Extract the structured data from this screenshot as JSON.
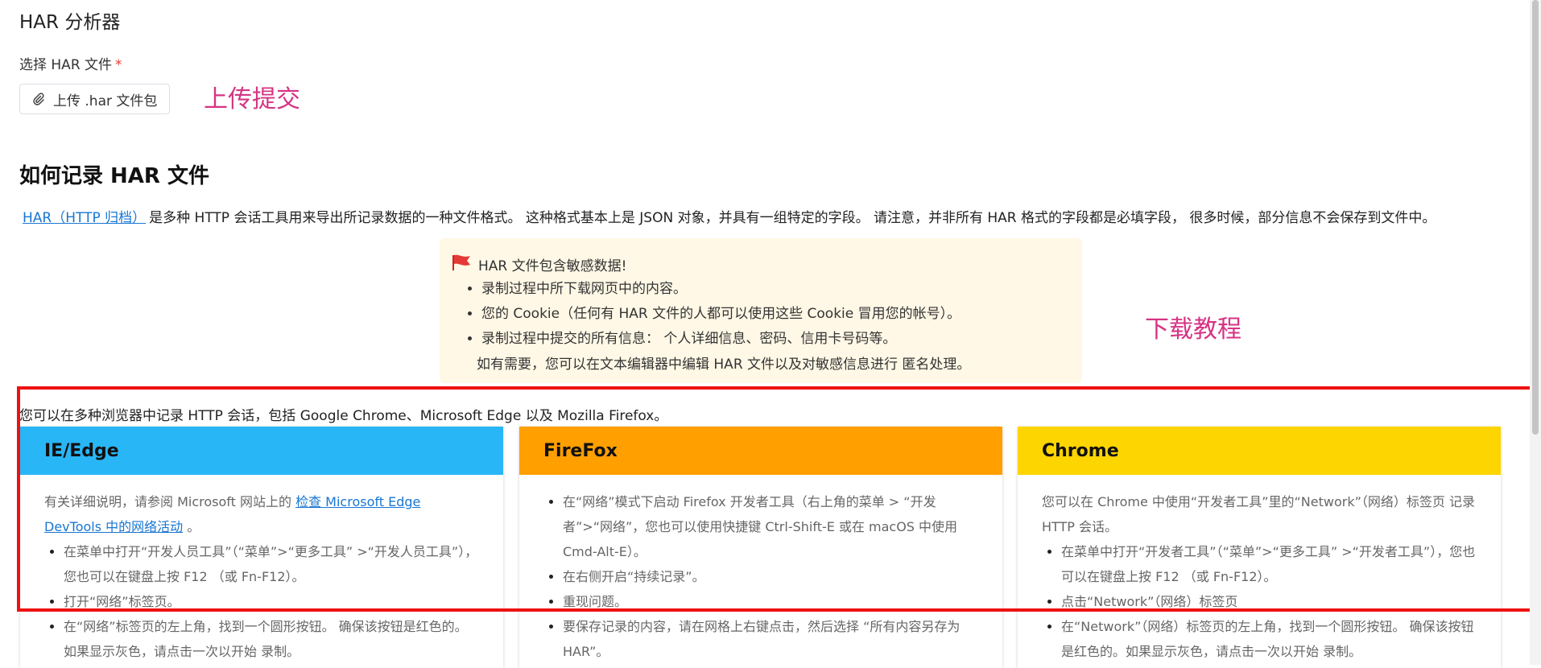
{
  "page": {
    "title": "HAR 分析器",
    "file_label": "选择 HAR 文件",
    "required_mark": "*",
    "upload_button": "上传 .har 文件包"
  },
  "annotations": {
    "upload": "上传提交",
    "download": "下载教程"
  },
  "section": {
    "title": "如何记录 HAR 文件",
    "intro_link": "HAR（HTTP 归档）",
    "intro_text": "是多种 HTTP 会话工具用来导出所记录数据的一种文件格式。 这种格式基本上是 JSON 对象，并具有一组特定的字段。 请注意，并非所有 HAR 格式的字段都是必填字段， 很多时候，部分信息不会保存到文件中。"
  },
  "warning": {
    "title": "HAR 文件包含敏感数据!",
    "items": [
      "录制过程中所下载网页中的内容。",
      "您的 Cookie（任何有 HAR 文件的人都可以使用这些 Cookie 冒用您的帐号）。",
      "录制过程中提交的所有信息： 个人详细信息、密码、信用卡号码等。"
    ],
    "footer": "如有需要，您可以在文本编辑器中编辑 HAR 文件以及对敏感信息进行 匿名处理。"
  },
  "browsers": {
    "intro": "您可以在多种浏览器中记录 HTTP 会话，包括 Google Chrome、Microsoft Edge 以及 Mozilla Firefox。",
    "cards": [
      {
        "title": "IE/Edge",
        "color": "#29b6f6",
        "para_pre": "有关详细说明，请参阅 Microsoft 网站上的",
        "para_link": "检查 Microsoft Edge DevTools 中的网络活动",
        "para_post": "。",
        "items": [
          "在菜单中打开“开发人员工具”（“菜单”>“更多工具” >“开发人员工具”），您也可以在键盘上按 F12 （或 Fn-F12）。",
          "打开“网络”标签页。",
          "在“网络”标签页的左上角，找到一个圆形按钮。 确保该按钮是红色的。 如果显示灰色，请点击一次以开始 录制。"
        ]
      },
      {
        "title": "FireFox",
        "color": "#ff9f00",
        "items": [
          "在“网络”模式下启动 Firefox 开发者工具（右上角的菜单 > “开发者”>“网络”，您也可以使用快捷键 Ctrl-Shift-E 或在 macOS 中使用 Cmd-Alt-E）。",
          "在右侧开启“持续记录”。",
          "重现问题。",
          "要保存记录的内容，请在网格上右键点击，然后选择 “所有内容另存为 HAR”。"
        ]
      },
      {
        "title": "Chrome",
        "color": "#fdd500",
        "para": "您可以在 Chrome 中使用“开发者工具”里的“Network”（网络）标签页 记录 HTTP 会话。",
        "items": [
          "在菜单中打开“开发者工具”（“菜单”>“更多工具” >“开发者工具”），您也可以在键盘上按 F12 （或 Fn-F12）。",
          "点击“Network”（网络）标签页",
          "在“Network”（网络）标签页的左上角，找到一个圆形按钮。 确保该按钮是红色的。如果显示灰色，请点击一次以开始 录制。"
        ]
      }
    ]
  },
  "colors": {
    "annotation": "#d63384",
    "highlight": "#ee1111",
    "warning_bg": "#fff8e6",
    "link": "#1976d2",
    "flag": "#e53935"
  }
}
